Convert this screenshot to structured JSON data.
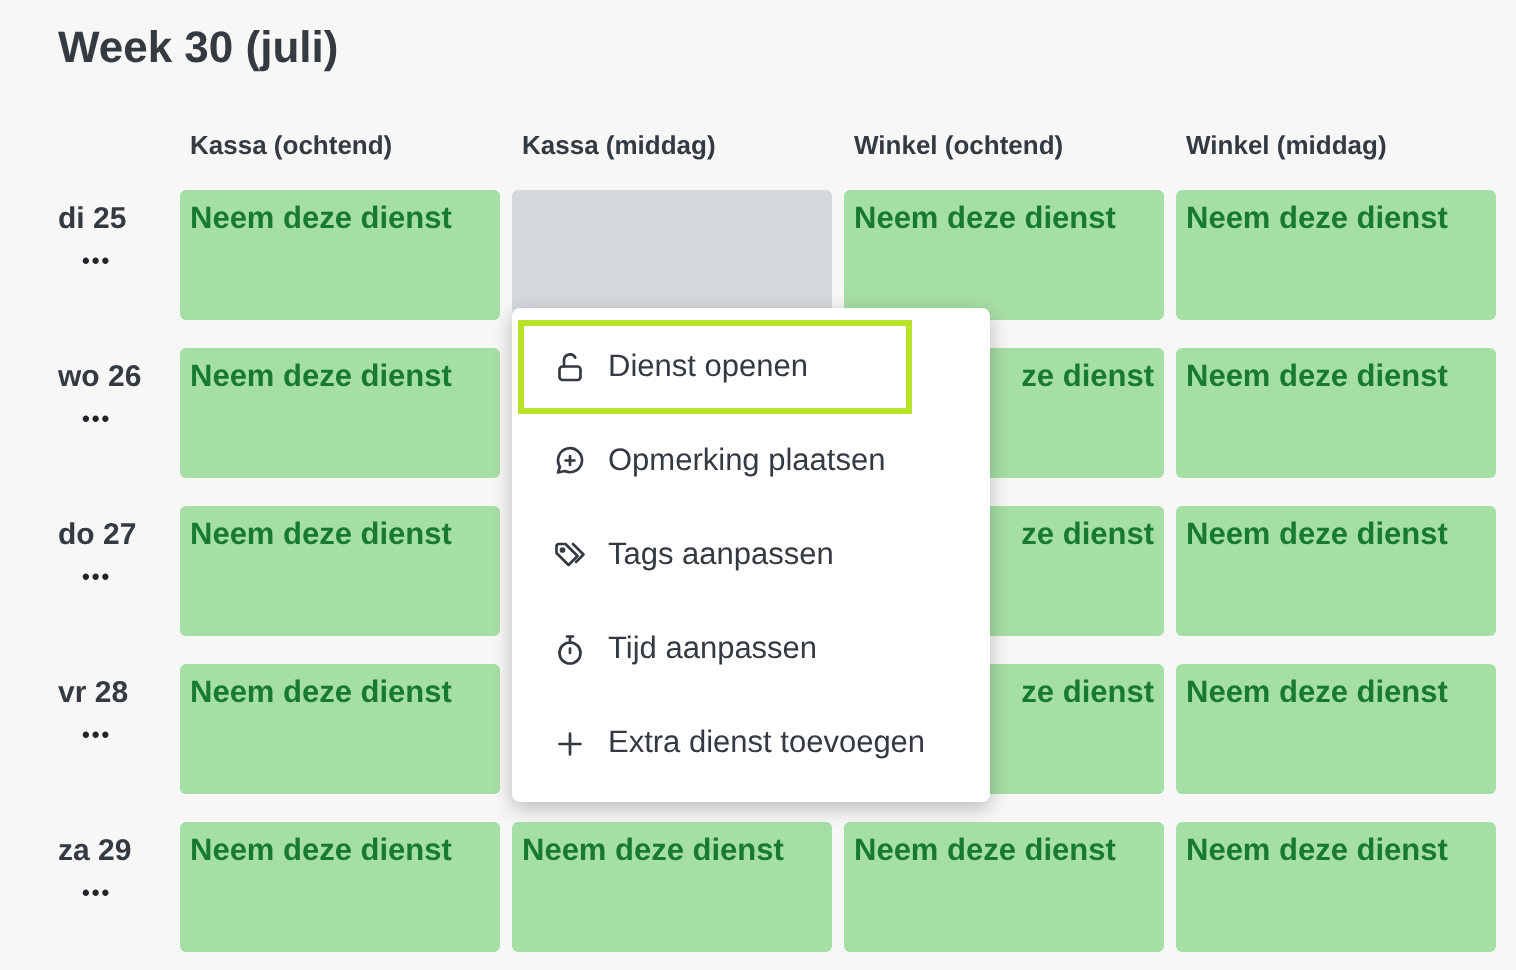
{
  "title": "Week 30 (juli)",
  "columns": [
    "Kassa (ochtend)",
    "Kassa (middag)",
    "Winkel (ochtend)",
    "Winkel (middag)"
  ],
  "rows": [
    {
      "day": "di 25",
      "more": "•••",
      "cells": [
        {
          "kind": "open",
          "text": "Neem deze dienst"
        },
        {
          "kind": "empty"
        },
        {
          "kind": "open",
          "text": "Neem deze dienst"
        },
        {
          "kind": "open",
          "text": "Neem deze dienst"
        }
      ]
    },
    {
      "day": "wo 26",
      "more": "•••",
      "cells": [
        {
          "kind": "open",
          "text": "Neem deze dienst"
        },
        null,
        {
          "kind": "covered",
          "text": "ze dienst"
        },
        {
          "kind": "open",
          "text": "Neem deze dienst"
        }
      ]
    },
    {
      "day": "do 27",
      "more": "•••",
      "cells": [
        {
          "kind": "open",
          "text": "Neem deze dienst"
        },
        null,
        {
          "kind": "covered",
          "text": "ze dienst"
        },
        {
          "kind": "open",
          "text": "Neem deze dienst"
        }
      ]
    },
    {
      "day": "vr 28",
      "more": "•••",
      "cells": [
        {
          "kind": "open",
          "text": "Neem deze dienst"
        },
        null,
        {
          "kind": "covered",
          "text": "ze dienst"
        },
        {
          "kind": "open",
          "text": "Neem deze dienst"
        }
      ]
    },
    {
      "day": "za 29",
      "more": "•••",
      "cells": [
        {
          "kind": "open",
          "text": "Neem deze dienst"
        },
        {
          "kind": "open",
          "text": "Neem deze dienst"
        },
        {
          "kind": "open",
          "text": "Neem deze dienst"
        },
        {
          "kind": "open",
          "text": "Neem deze dienst"
        }
      ]
    }
  ],
  "context_menu": {
    "items": [
      {
        "label": "Dienst openen",
        "selected": true
      },
      {
        "label": "Opmerking plaatsen",
        "selected": false
      },
      {
        "label": "Tags aanpassen",
        "selected": false
      },
      {
        "label": "Tijd aanpassen",
        "selected": false
      },
      {
        "label": "Extra dienst toevoegen",
        "selected": false
      }
    ]
  }
}
